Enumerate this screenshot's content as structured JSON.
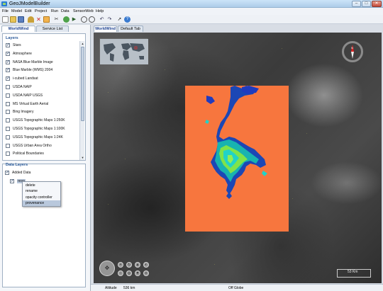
{
  "window": {
    "title": "GeoJModelBuilder",
    "minimize": "–",
    "maximize": "□",
    "close": "✕"
  },
  "menu": [
    "File",
    "Model",
    "Edit",
    "Project",
    "Run",
    "Data",
    "SensorWeb",
    "Help"
  ],
  "toolbar_icons": [
    "new-icon",
    "open-icon",
    "save-icon",
    "up-icon",
    "cut-icon",
    "copy-icon",
    "scissors-icon",
    "refresh-icon",
    "run-icon",
    "zoom-in-icon",
    "zoom-out-icon",
    "undo-icon",
    "redo-icon",
    "pointer-icon",
    "help-icon"
  ],
  "left_tabs": [
    "WorldWind",
    "Service List"
  ],
  "layers": {
    "title": "Layers",
    "items": [
      {
        "label": "Stars",
        "checked": true
      },
      {
        "label": "Atmosphere",
        "checked": true
      },
      {
        "label": "NASA Blue Marble Image",
        "checked": true
      },
      {
        "label": "Blue Marble (WMS) 2004",
        "checked": true
      },
      {
        "label": "i-cubed Landsat",
        "checked": true
      },
      {
        "label": "USDA NAIP",
        "checked": false
      },
      {
        "label": "USDA NAIP USGS",
        "checked": false
      },
      {
        "label": "MS Virtual Earth Aerial",
        "checked": false
      },
      {
        "label": "Bing Imagery",
        "checked": false
      },
      {
        "label": "USGS Topographic Maps 1:250K",
        "checked": false
      },
      {
        "label": "USGS Topographic Maps 1:100K",
        "checked": false
      },
      {
        "label": "USGS Topographic Maps 1:24K",
        "checked": false
      },
      {
        "label": "USGS Urban Area Ortho",
        "checked": false
      },
      {
        "label": "Political Boundaries",
        "checked": false
      }
    ]
  },
  "data_layers": {
    "title": "Data Layers",
    "added_label": "Added Data",
    "child_label": "reso"
  },
  "context_menu": [
    {
      "label": "delete",
      "selected": false
    },
    {
      "label": "rename",
      "selected": false
    },
    {
      "label": "opacity controller",
      "selected": false
    },
    {
      "label": "provenance",
      "selected": true
    }
  ],
  "map_tabs": [
    "WorldWind",
    "Default Tab"
  ],
  "scale": "53 Km",
  "status": {
    "altitude_label": "Altitude",
    "altitude_value": "536 km",
    "globe_status": "Off Globe"
  }
}
